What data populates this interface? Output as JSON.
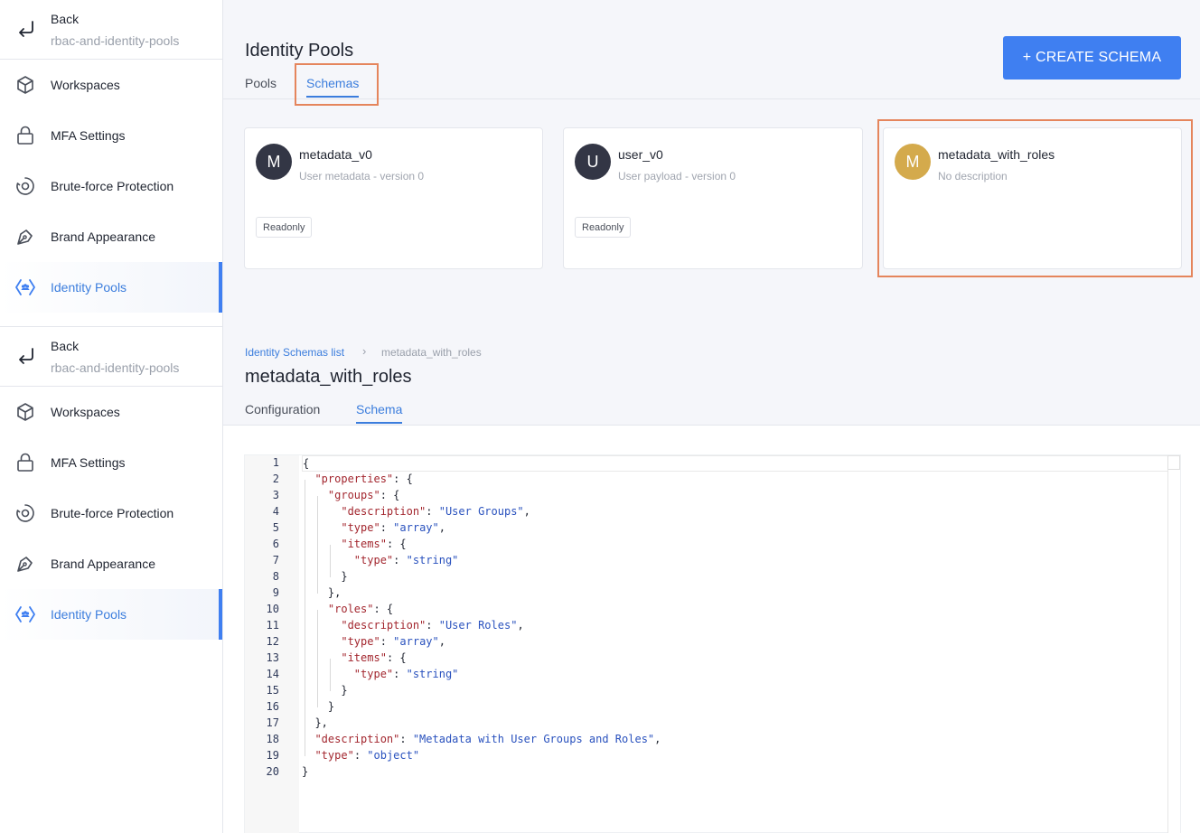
{
  "sidebar": {
    "back_label": "Back",
    "back_sub": "rbac-and-identity-pools",
    "items": [
      {
        "label": "Workspaces",
        "icon": "cube-icon"
      },
      {
        "label": "MFA Settings",
        "icon": "lock-icon"
      },
      {
        "label": "Brute-force Protection",
        "icon": "shield-target-icon"
      },
      {
        "label": "Brand Appearance",
        "icon": "pen-nib-icon"
      },
      {
        "label": "Identity Pools",
        "icon": "identity-pool-icon",
        "active": true
      }
    ],
    "accent": "#3f7ff1"
  },
  "top": {
    "title": "Identity Pools",
    "create_button": "+ CREATE SCHEMA",
    "tabs": {
      "pools": "Pools",
      "schemas": "Schemas"
    },
    "cards": [
      {
        "avatar": "M",
        "name": "metadata_v0",
        "desc": "User metadata - version 0",
        "badge": "Readonly"
      },
      {
        "avatar": "U",
        "name": "user_v0",
        "desc": "User payload - version 0",
        "badge": "Readonly"
      },
      {
        "avatar": "M",
        "name": "metadata_with_roles",
        "desc": "No description"
      }
    ],
    "highlight_color": "#e5855c"
  },
  "detail": {
    "breadcrumb_link": "Identity Schemas list",
    "breadcrumb_sep": "›",
    "breadcrumb_current": "metadata_with_roles",
    "title": "metadata_with_roles",
    "tabs": {
      "configuration": "Configuration",
      "schema": "Schema"
    }
  },
  "code": {
    "line_numbers": [
      "1",
      "2",
      "3",
      "4",
      "5",
      "6",
      "7",
      "8",
      "9",
      "10",
      "11",
      "12",
      "13",
      "14",
      "15",
      "16",
      "17",
      "18",
      "19",
      "20"
    ],
    "lines": [
      [
        {
          "t": "p",
          "v": "{"
        }
      ],
      [
        {
          "t": "p",
          "v": "  "
        },
        {
          "t": "k",
          "v": "\"properties\""
        },
        {
          "t": "p",
          "v": ": {"
        }
      ],
      [
        {
          "t": "p",
          "v": "    "
        },
        {
          "t": "k",
          "v": "\"groups\""
        },
        {
          "t": "p",
          "v": ": {"
        }
      ],
      [
        {
          "t": "p",
          "v": "      "
        },
        {
          "t": "k",
          "v": "\"description\""
        },
        {
          "t": "p",
          "v": ": "
        },
        {
          "t": "s",
          "v": "\"User Groups\""
        },
        {
          "t": "p",
          "v": ","
        }
      ],
      [
        {
          "t": "p",
          "v": "      "
        },
        {
          "t": "k",
          "v": "\"type\""
        },
        {
          "t": "p",
          "v": ": "
        },
        {
          "t": "s",
          "v": "\"array\""
        },
        {
          "t": "p",
          "v": ","
        }
      ],
      [
        {
          "t": "p",
          "v": "      "
        },
        {
          "t": "k",
          "v": "\"items\""
        },
        {
          "t": "p",
          "v": ": {"
        }
      ],
      [
        {
          "t": "p",
          "v": "        "
        },
        {
          "t": "k",
          "v": "\"type\""
        },
        {
          "t": "p",
          "v": ": "
        },
        {
          "t": "s",
          "v": "\"string\""
        }
      ],
      [
        {
          "t": "p",
          "v": "      }"
        }
      ],
      [
        {
          "t": "p",
          "v": "    },"
        }
      ],
      [
        {
          "t": "p",
          "v": "    "
        },
        {
          "t": "k",
          "v": "\"roles\""
        },
        {
          "t": "p",
          "v": ": {"
        }
      ],
      [
        {
          "t": "p",
          "v": "      "
        },
        {
          "t": "k",
          "v": "\"description\""
        },
        {
          "t": "p",
          "v": ": "
        },
        {
          "t": "s",
          "v": "\"User Roles\""
        },
        {
          "t": "p",
          "v": ","
        }
      ],
      [
        {
          "t": "p",
          "v": "      "
        },
        {
          "t": "k",
          "v": "\"type\""
        },
        {
          "t": "p",
          "v": ": "
        },
        {
          "t": "s",
          "v": "\"array\""
        },
        {
          "t": "p",
          "v": ","
        }
      ],
      [
        {
          "t": "p",
          "v": "      "
        },
        {
          "t": "k",
          "v": "\"items\""
        },
        {
          "t": "p",
          "v": ": {"
        }
      ],
      [
        {
          "t": "p",
          "v": "        "
        },
        {
          "t": "k",
          "v": "\"type\""
        },
        {
          "t": "p",
          "v": ": "
        },
        {
          "t": "s",
          "v": "\"string\""
        }
      ],
      [
        {
          "t": "p",
          "v": "      }"
        }
      ],
      [
        {
          "t": "p",
          "v": "    }"
        }
      ],
      [
        {
          "t": "p",
          "v": "  },"
        }
      ],
      [
        {
          "t": "p",
          "v": "  "
        },
        {
          "t": "k",
          "v": "\"description\""
        },
        {
          "t": "p",
          "v": ": "
        },
        {
          "t": "s",
          "v": "\"Metadata with User Groups and Roles\""
        },
        {
          "t": "p",
          "v": ","
        }
      ],
      [
        {
          "t": "p",
          "v": "  "
        },
        {
          "t": "k",
          "v": "\"type\""
        },
        {
          "t": "p",
          "v": ": "
        },
        {
          "t": "s",
          "v": "\"object\""
        }
      ],
      [
        {
          "t": "p",
          "v": "}"
        }
      ]
    ]
  }
}
